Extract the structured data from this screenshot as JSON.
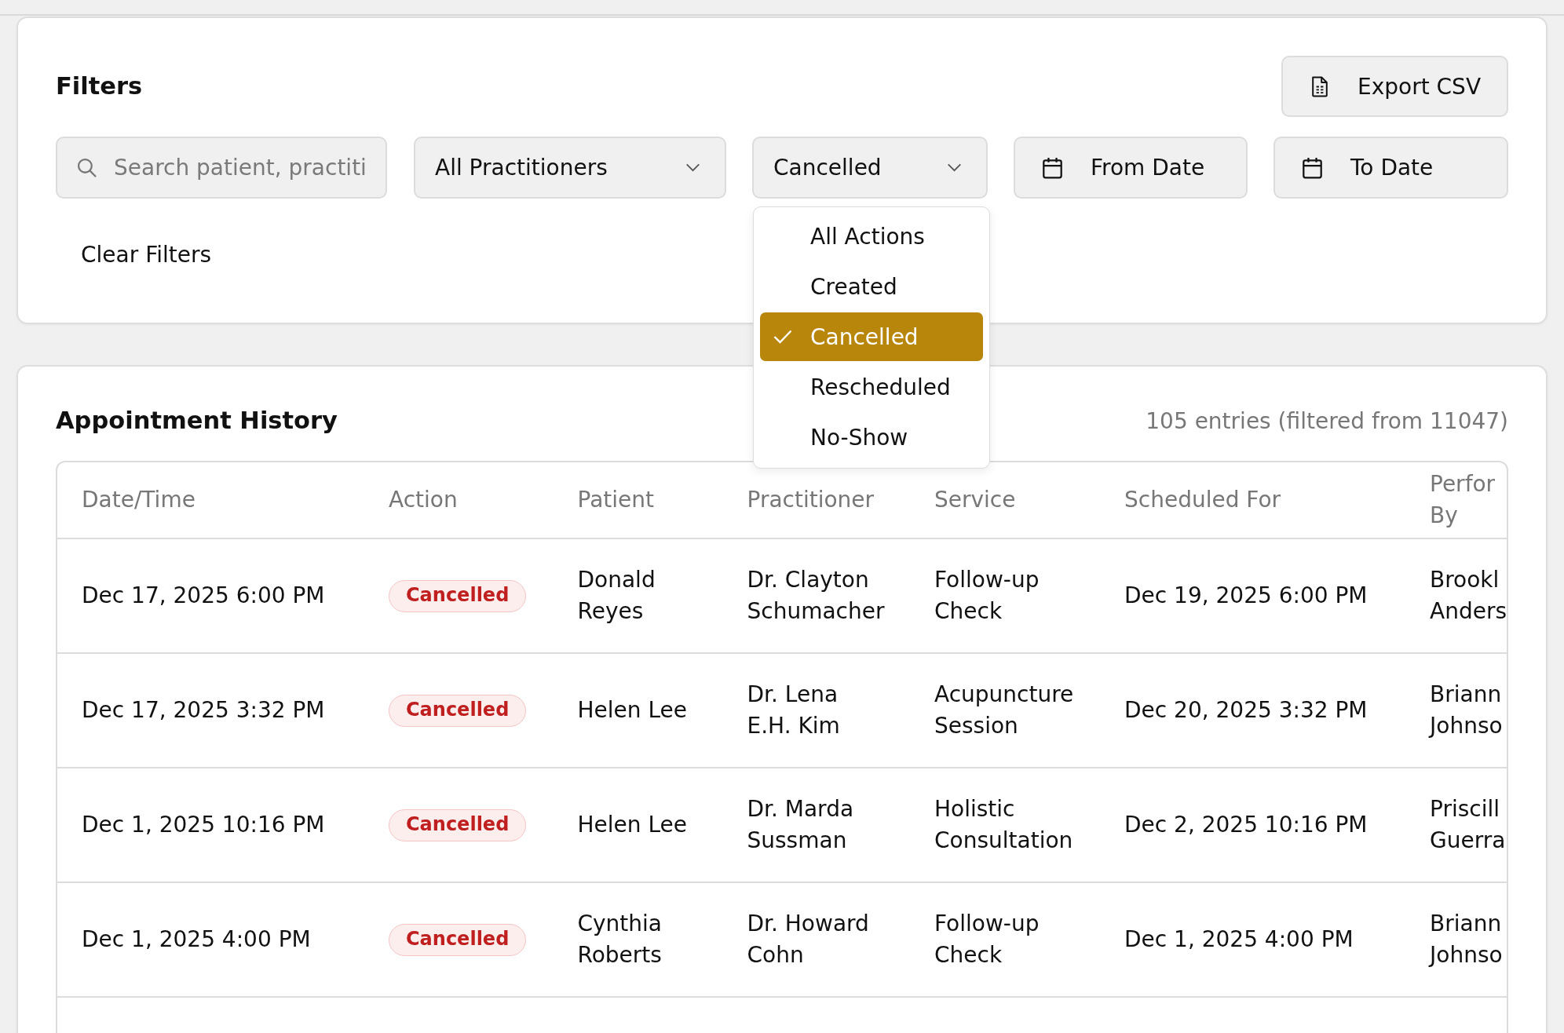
{
  "filters": {
    "title": "Filters",
    "export_button": {
      "label": "Export CSV"
    },
    "search": {
      "placeholder": "Search patient, practiti"
    },
    "practitioner_select": {
      "value": "All Practitioners"
    },
    "action_select": {
      "value": "Cancelled",
      "expanded": true,
      "options": [
        {
          "label": "All Actions",
          "selected": false
        },
        {
          "label": "Created",
          "selected": false
        },
        {
          "label": "Cancelled",
          "selected": true
        },
        {
          "label": "Rescheduled",
          "selected": false
        },
        {
          "label": "No-Show",
          "selected": false
        }
      ]
    },
    "from_date": {
      "label": "From Date"
    },
    "to_date": {
      "label": "To Date"
    },
    "clear_button": {
      "label": "Clear Filters"
    }
  },
  "history": {
    "title": "Appointment History",
    "entries": "105 entries (filtered from 11047)",
    "table": {
      "columns": [
        "Date/Time",
        "Action",
        "Patient",
        "Practitioner",
        "Service",
        "Scheduled For",
        "Perfor By"
      ],
      "rows": [
        {
          "date_time": "Dec 17, 2025 6:00 PM",
          "action": "Cancelled",
          "patient": "Donald Reyes",
          "practitioner": "Dr. Clayton Schumacher",
          "service": "Follow-up Check",
          "scheduled_for": "Dec 19, 2025 6:00 PM",
          "column_7": "Brookl Anders"
        },
        {
          "date_time": "Dec 17, 2025 3:32 PM",
          "action": "Cancelled",
          "patient": "Helen Lee",
          "practitioner": "Dr. Lena E.H. Kim",
          "service": "Acupuncture Session",
          "scheduled_for": "Dec 20, 2025 3:32 PM",
          "column_7": "Briann Johnso"
        },
        {
          "date_time": "Dec 1, 2025 10:16 PM",
          "action": "Cancelled",
          "patient": "Helen Lee",
          "practitioner": "Dr. Marda Sussman",
          "service": "Holistic Consultation",
          "scheduled_for": "Dec 2, 2025 10:16 PM",
          "column_7": "Priscill Guerra"
        },
        {
          "date_time": "Dec 1, 2025 4:00 PM",
          "action": "Cancelled",
          "patient": "Cynthia Roberts",
          "practitioner": "Dr. Howard Cohn",
          "service": "Follow-up Check",
          "scheduled_for": "Dec 1, 2025 4:00 PM",
          "column_7": "Briann Johnso"
        }
      ]
    }
  }
}
